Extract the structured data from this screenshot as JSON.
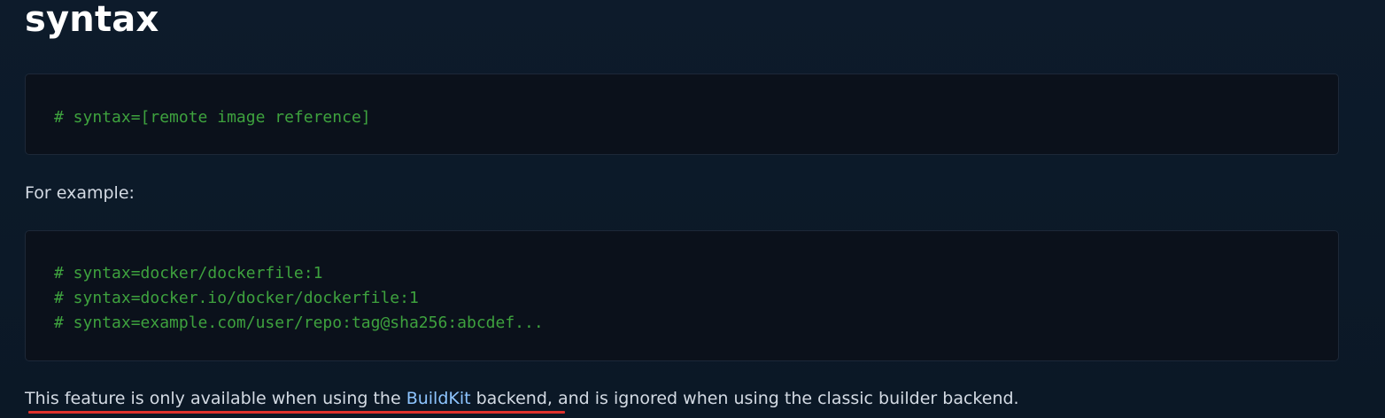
{
  "heading": "syntax",
  "code_block_1": {
    "lines": [
      "# syntax=[remote image reference]"
    ]
  },
  "example_label": "For example:",
  "code_block_2": {
    "lines": [
      "# syntax=docker/dockerfile:1",
      "# syntax=docker.io/docker/dockerfile:1",
      "# syntax=example.com/user/repo:tag@sha256:abcdef..."
    ]
  },
  "note": {
    "before_link": "This feature is only available when using the ",
    "link_text": "BuildKit",
    "after_link": " backend, and is ignored when using the classic builder backend."
  },
  "colors": {
    "background": "#0c1a2a",
    "code_background": "#0b111b",
    "code_text": "#3ea23e",
    "link": "#8ec5ff",
    "annotation": "#e0322d"
  }
}
